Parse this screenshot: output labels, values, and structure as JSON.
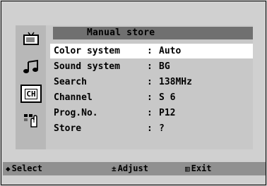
{
  "menu": {
    "title": "Manual store",
    "icons": [
      {
        "name": "tv-icon",
        "active": false
      },
      {
        "name": "sound-icon",
        "active": false
      },
      {
        "name": "channel-icon",
        "active": true,
        "text": "CH"
      },
      {
        "name": "setup-icon",
        "active": false
      }
    ],
    "rows": [
      {
        "label": "Color system",
        "value": "Auto",
        "selected": true
      },
      {
        "label": "Sound system",
        "value": "BG",
        "selected": false
      },
      {
        "label": "Search",
        "value": "138MHz",
        "selected": false
      },
      {
        "label": "Channel",
        "value": "S 6",
        "selected": false
      },
      {
        "label": "Prog.No.",
        "value": "P12",
        "selected": false
      },
      {
        "label": "Store",
        "value": "?",
        "selected": false
      }
    ],
    "separator": ":"
  },
  "footer": {
    "select": {
      "symbol": "◆",
      "label": "Select"
    },
    "adjust": {
      "symbol": "±",
      "label": "Adjust"
    },
    "exit": {
      "symbol": "▥",
      "label": "Exit"
    }
  }
}
